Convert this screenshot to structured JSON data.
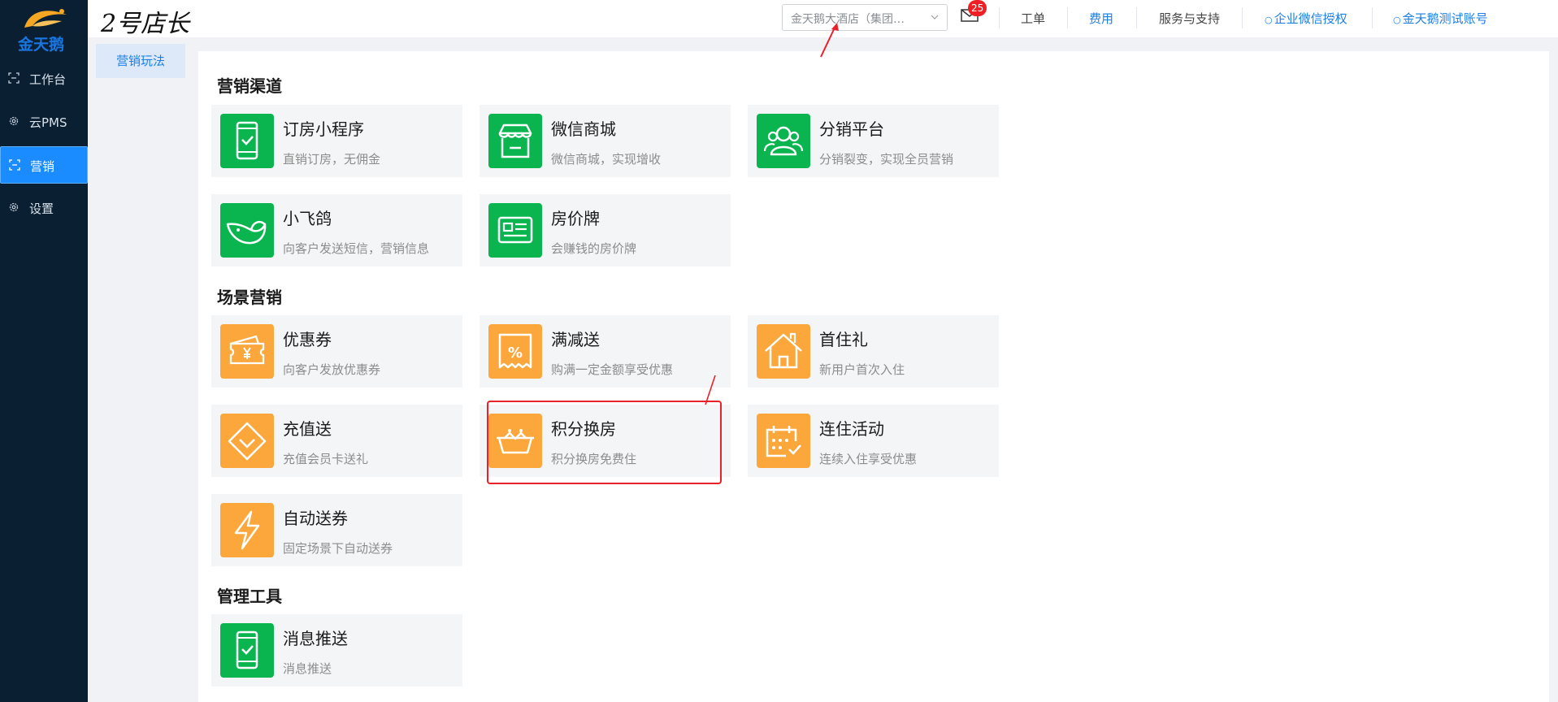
{
  "app": {
    "logo_text": "金天鹅",
    "brand_title": "2号店长"
  },
  "sidebar": {
    "items": [
      {
        "label": "工作台",
        "icon": "workbench-icon",
        "active": false
      },
      {
        "label": "云PMS",
        "icon": "gear-icon",
        "active": false
      },
      {
        "label": "营销",
        "icon": "marketing-icon",
        "active": true
      },
      {
        "label": "设置",
        "icon": "gear-icon",
        "active": false
      }
    ]
  },
  "header": {
    "hotel_select_value": "金天鹅大酒店（集团…",
    "mail_badge_count": "25",
    "links": {
      "ticket": "工单",
      "fees": "费用",
      "service": "服务与支持",
      "wecom_auth": "企业微信授权",
      "account": "金天鹅测试账号"
    }
  },
  "subnav": {
    "active_item": "营销玩法"
  },
  "sections": [
    {
      "title": "营销渠道",
      "cards": [
        {
          "title": "订房小程序",
          "desc": "直销订房，无佣金",
          "icon": "phone-check-icon",
          "color": "#0ab550"
        },
        {
          "title": "微信商城",
          "desc": "微信商城，实现增收",
          "icon": "store-icon",
          "color": "#0ab550"
        },
        {
          "title": "分销平台",
          "desc": "分销裂变，实现全员营销",
          "icon": "users-icon",
          "color": "#0ab550"
        },
        {
          "title": "小飞鸽",
          "desc": "向客户发送短信，营销信息",
          "icon": "bird-icon",
          "color": "#0ab550"
        },
        {
          "title": "房价牌",
          "desc": "会赚钱的房价牌",
          "icon": "price-board-icon",
          "color": "#0ab550"
        }
      ]
    },
    {
      "title": "场景营销",
      "cards": [
        {
          "title": "优惠券",
          "desc": "向客户发放优惠券",
          "icon": "coupon-icon",
          "color": "#fba73b"
        },
        {
          "title": "满减送",
          "desc": "购满一定金额享受优惠",
          "icon": "discount-icon",
          "color": "#fba73b"
        },
        {
          "title": "首住礼",
          "desc": "新用户首次入住",
          "icon": "house-icon",
          "color": "#fba73b"
        },
        {
          "title": "充值送",
          "desc": "充值会员卡送礼",
          "icon": "diamond-icon",
          "color": "#fba73b"
        },
        {
          "title": "积分换房",
          "desc": "积分换房免费住",
          "icon": "crown-icon",
          "color": "#fba73b"
        },
        {
          "title": "连住活动",
          "desc": "连续入住享受优惠",
          "icon": "calendar-check-icon",
          "color": "#fba73b"
        },
        {
          "title": "自动送券",
          "desc": "固定场景下自动送券",
          "icon": "lightning-icon",
          "color": "#fba73b"
        }
      ]
    },
    {
      "title": "管理工具",
      "cards": [
        {
          "title": "消息推送",
          "desc": "消息推送",
          "icon": "phone-check-icon",
          "color": "#0ab550"
        }
      ]
    }
  ]
}
